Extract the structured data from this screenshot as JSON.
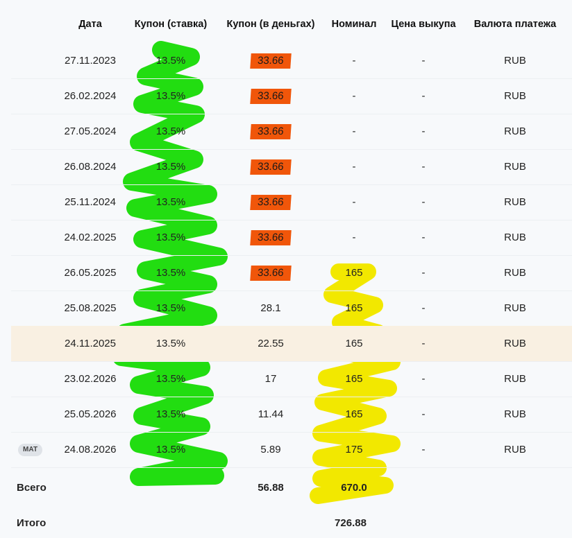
{
  "header": {
    "date": "Дата",
    "coupon_rate": "Купон (ставка)",
    "coupon_money": "Купон (в деньгах)",
    "nominal": "Номинал",
    "buyback_price": "Цена выкупа",
    "currency": "Валюта платежа"
  },
  "rows": [
    {
      "date": "27.11.2023",
      "rate": "13.5%",
      "money": "33.66",
      "nominal": "-",
      "price": "-",
      "currency": "RUB"
    },
    {
      "date": "26.02.2024",
      "rate": "13.5%",
      "money": "33.66",
      "nominal": "-",
      "price": "-",
      "currency": "RUB"
    },
    {
      "date": "27.05.2024",
      "rate": "13.5%",
      "money": "33.66",
      "nominal": "-",
      "price": "-",
      "currency": "RUB"
    },
    {
      "date": "26.08.2024",
      "rate": "13.5%",
      "money": "33.66",
      "nominal": "-",
      "price": "-",
      "currency": "RUB"
    },
    {
      "date": "25.11.2024",
      "rate": "13.5%",
      "money": "33.66",
      "nominal": "-",
      "price": "-",
      "currency": "RUB"
    },
    {
      "date": "24.02.2025",
      "rate": "13.5%",
      "money": "33.66",
      "nominal": "-",
      "price": "-",
      "currency": "RUB"
    },
    {
      "date": "26.05.2025",
      "rate": "13.5%",
      "money": "33.66",
      "nominal": "165",
      "price": "-",
      "currency": "RUB"
    },
    {
      "date": "25.08.2025",
      "rate": "13.5%",
      "money": "28.1",
      "nominal": "165",
      "price": "-",
      "currency": "RUB"
    },
    {
      "date": "24.11.2025",
      "rate": "13.5%",
      "money": "22.55",
      "nominal": "165",
      "price": "-",
      "currency": "RUB"
    },
    {
      "date": "23.02.2026",
      "rate": "13.5%",
      "money": "17",
      "nominal": "165",
      "price": "-",
      "currency": "RUB"
    },
    {
      "date": "25.05.2026",
      "rate": "13.5%",
      "money": "11.44",
      "nominal": "165",
      "price": "-",
      "currency": "RUB"
    },
    {
      "date": "24.08.2026",
      "rate": "13.5%",
      "money": "5.89",
      "nominal": "175",
      "price": "-",
      "currency": "RUB",
      "badge": "МАТ"
    }
  ],
  "totals": {
    "total_label": "Всего",
    "total_coupon": "56.88",
    "total_nominal": "670.0",
    "grand_label": "Итого",
    "grand_value": "726.88"
  },
  "colors": {
    "highlight_row": "#f9f0e2",
    "orange_mark": "#f0560a",
    "green_scribble": "#22dd11",
    "yellow_scribble": "#f2e800"
  },
  "highlighted_row_index": 8
}
